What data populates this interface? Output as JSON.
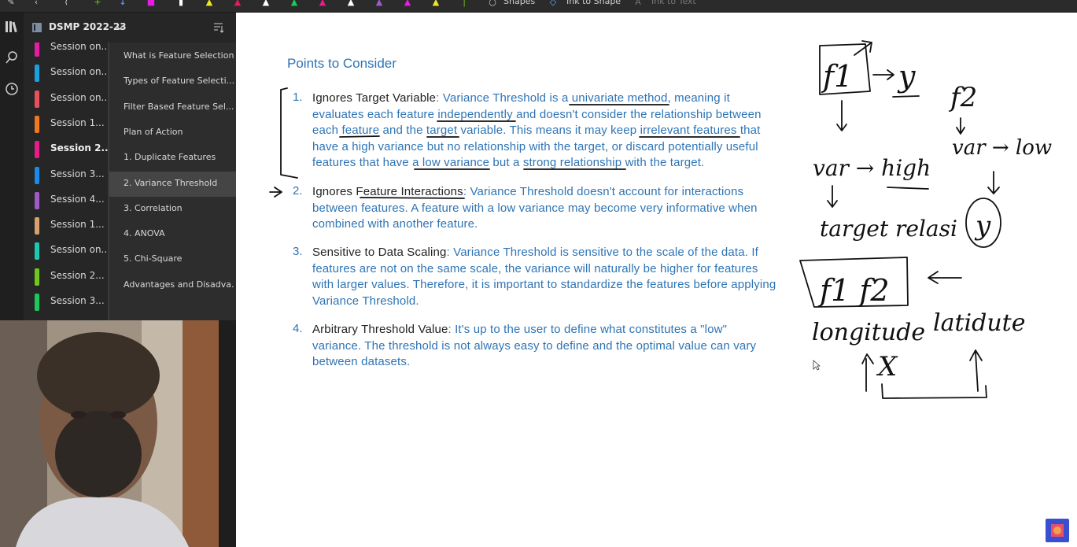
{
  "toolbar": {
    "shapes_label": "Shapes",
    "ink_to_shape_label": "Ink to Shape",
    "ink_to_text_label": "Ink to Text"
  },
  "notebook": {
    "title": "DSMP 2022-23"
  },
  "sections": [
    {
      "label": "Session on...",
      "color": "#e81ba7"
    },
    {
      "label": "Session on...",
      "color": "#1ba1e2"
    },
    {
      "label": "Session on...",
      "color": "#e8505b"
    },
    {
      "label": "Session 1...",
      "color": "#f0781e"
    },
    {
      "label": "Session 2...",
      "color": "#e81b8a",
      "bold": true
    },
    {
      "label": "Session 3...",
      "color": "#1b8ae8"
    },
    {
      "label": "Session 4...",
      "color": "#a05ac8"
    },
    {
      "label": "Session 1...",
      "color": "#d8a070"
    },
    {
      "label": "Session on...",
      "color": "#1bc8b0"
    },
    {
      "label": "Session 2...",
      "color": "#6ec81b"
    },
    {
      "label": "Session 3...",
      "color": "#1bc85a"
    }
  ],
  "pages": [
    {
      "label": "What is Feature Selection"
    },
    {
      "label": "Types of Feature Selecti..."
    },
    {
      "label": "Filter Based Feature Sel..."
    },
    {
      "label": "Plan of Action"
    },
    {
      "label": "1. Duplicate Features"
    },
    {
      "label": "2. Variance Threshold",
      "selected": true
    },
    {
      "label": "3. Correlation"
    },
    {
      "label": "4. ANOVA"
    },
    {
      "label": "5. Chi-Square"
    },
    {
      "label": "Advantages and Disadva..."
    }
  ],
  "note": {
    "heading": "Points to Consider",
    "items": [
      {
        "num": "1.",
        "term": "Ignores Target Variable",
        "text": ": Variance Threshold is a univariate method, meaning it evaluates each feature independently and doesn't consider the relationship between each feature and the target variable. This means it may keep irrelevant features that have a high variance but no relationship with the target, or discard potentially useful features that have a low variance but a strong relationship with the target."
      },
      {
        "num": "2.",
        "term": "Ignores Feature Interactions",
        "text": ": Variance Threshold doesn't account for interactions between features. A feature with a low variance may become very informative when combined with another feature."
      },
      {
        "num": "3.",
        "term": "Sensitive to Data Scaling",
        "text": ": Variance Threshold is sensitive to the scale of the data. If features are not on the same scale, the variance will naturally be higher for features with larger values. Therefore, it is important to standardize the features before applying Variance Threshold."
      },
      {
        "num": "4.",
        "term": "Arbitrary Threshold Value",
        "text": ": It's up to the user to define what constitutes a \"low\" variance. The threshold is not always easy to define and the optimal value can vary between datasets."
      }
    ]
  },
  "ink": {
    "f1": "f1",
    "y": "y",
    "f2": "f2",
    "var_high": "var → high",
    "var_low": "var → low",
    "y_circle": "y",
    "target_relation": "target relasi",
    "box_features": "f1 f2",
    "longitude": "longitude",
    "latitude": "latidute",
    "x": "X"
  }
}
